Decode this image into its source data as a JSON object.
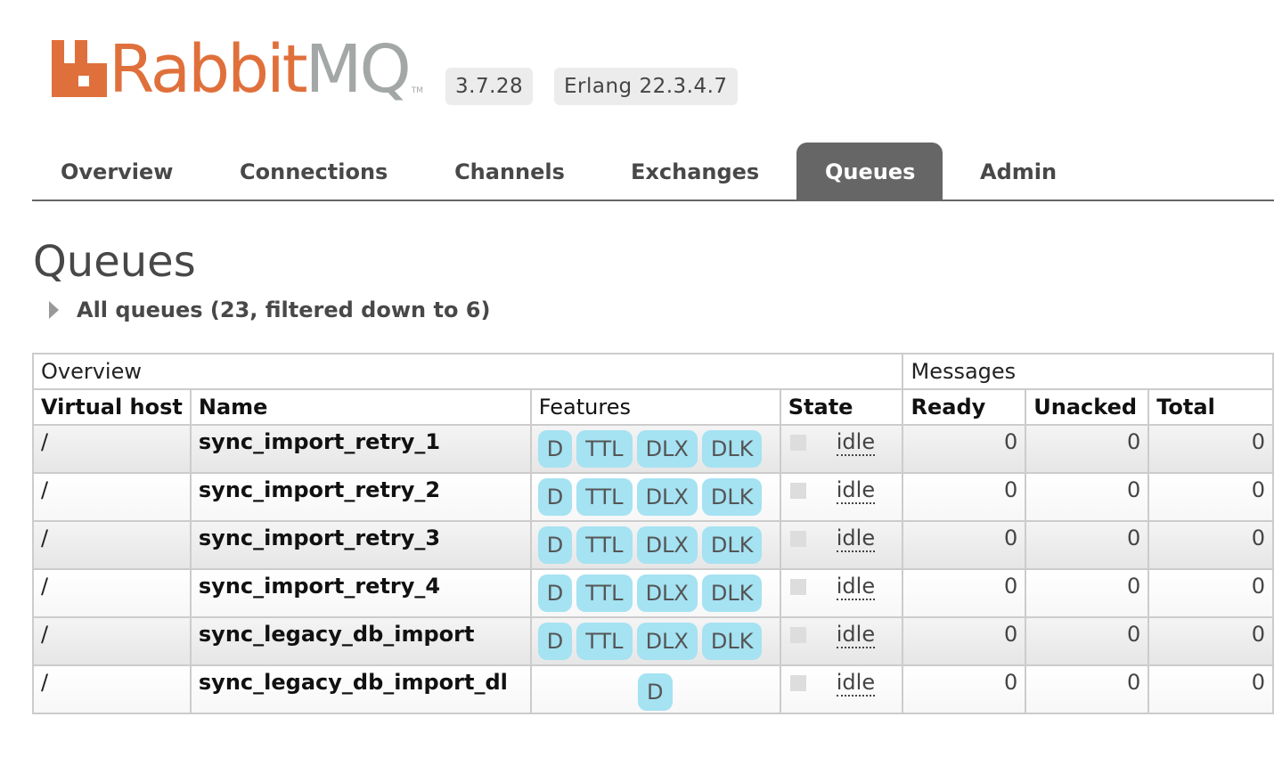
{
  "brand": {
    "rabbit": "Rabbit",
    "mq": "MQ",
    "tm": "TM",
    "color": "#e0703b"
  },
  "header": {
    "version": "3.7.28",
    "erlang": "Erlang 22.3.4.7"
  },
  "tabs": [
    {
      "label": "Overview",
      "active": false
    },
    {
      "label": "Connections",
      "active": false
    },
    {
      "label": "Channels",
      "active": false
    },
    {
      "label": "Exchanges",
      "active": false
    },
    {
      "label": "Queues",
      "active": true
    },
    {
      "label": "Admin",
      "active": false
    }
  ],
  "page": {
    "title": "Queues",
    "filter_label": "All queues (23, filtered down to 6)"
  },
  "table": {
    "groups": {
      "overview": "Overview",
      "messages": "Messages"
    },
    "columns": {
      "vhost": "Virtual host",
      "name": "Name",
      "features": "Features",
      "state": "State",
      "ready": "Ready",
      "unacked": "Unacked",
      "total": "Total"
    },
    "rows": [
      {
        "vhost": "/",
        "name": "sync_import_retry_1",
        "features": [
          "D",
          "TTL",
          "DLX",
          "DLK"
        ],
        "state": "idle",
        "ready": "0",
        "unacked": "0",
        "total": "0"
      },
      {
        "vhost": "/",
        "name": "sync_import_retry_2",
        "features": [
          "D",
          "TTL",
          "DLX",
          "DLK"
        ],
        "state": "idle",
        "ready": "0",
        "unacked": "0",
        "total": "0"
      },
      {
        "vhost": "/",
        "name": "sync_import_retry_3",
        "features": [
          "D",
          "TTL",
          "DLX",
          "DLK"
        ],
        "state": "idle",
        "ready": "0",
        "unacked": "0",
        "total": "0"
      },
      {
        "vhost": "/",
        "name": "sync_import_retry_4",
        "features": [
          "D",
          "TTL",
          "DLX",
          "DLK"
        ],
        "state": "idle",
        "ready": "0",
        "unacked": "0",
        "total": "0"
      },
      {
        "vhost": "/",
        "name": "sync_legacy_db_import",
        "features": [
          "D",
          "TTL",
          "DLX",
          "DLK"
        ],
        "state": "idle",
        "ready": "0",
        "unacked": "0",
        "total": "0"
      },
      {
        "vhost": "/",
        "name": "sync_legacy_db_import_dl",
        "features": [
          "D"
        ],
        "state": "idle",
        "ready": "0",
        "unacked": "0",
        "total": "0"
      }
    ]
  }
}
